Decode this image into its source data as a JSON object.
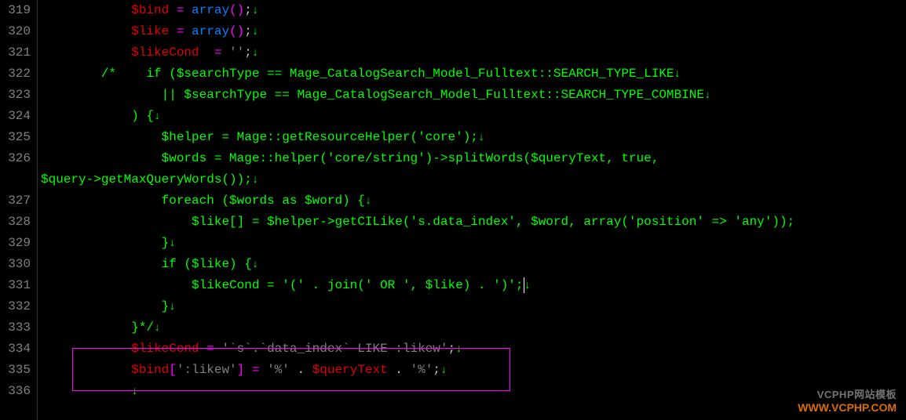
{
  "gutter": {
    "lines": [
      "319",
      "320",
      "321",
      "322",
      "323",
      "324",
      "325",
      "326",
      "",
      "327",
      "328",
      "329",
      "330",
      "331",
      "332",
      "333",
      "334",
      "335",
      "336"
    ]
  },
  "code": {
    "l319": {
      "indent": "            ",
      "var": "$bind",
      "eq": " = ",
      "op": "array",
      "paren": "()",
      "semi": ";"
    },
    "l320": {
      "indent": "            ",
      "var": "$like",
      "eq": " = ",
      "op": "array",
      "paren": "()",
      "semi": ";"
    },
    "l321": {
      "indent": "            ",
      "var": "$likeCond",
      "eq": "  = ",
      "str": "''",
      "semi": ";"
    },
    "l322": {
      "indent": "        ",
      "cp": "/*",
      "cg": "    if ($searchType == Mage_CatalogSearch_Model_Fulltext::SEARCH_TYPE_LIKE"
    },
    "l323": {
      "indent": "                ",
      "cg": "|| $searchType == Mage_CatalogSearch_Model_Fulltext::SEARCH_TYPE_COMBINE"
    },
    "l324": {
      "indent": "            ",
      "cg": ") {"
    },
    "l325": {
      "indent": "                ",
      "cg": "$helper = Mage::getResourceHelper('core');"
    },
    "l326a": {
      "indent": "                ",
      "cg": "$words = Mage::helper('core/string')->splitWords($queryText, true, "
    },
    "l326b": {
      "cg": "$query->getMaxQueryWords());"
    },
    "l327": {
      "indent": "                ",
      "cg": "foreach ($words as $word) {"
    },
    "l328": {
      "indent": "                    ",
      "cg": "$like[] = $helper->getCILike('s.data_index', $word, array('position' => 'any'));"
    },
    "l329": {
      "indent": "                ",
      "cg": "}"
    },
    "l330": {
      "indent": "                ",
      "cg": "if ($like) {"
    },
    "l331": {
      "indent": "                    ",
      "cg": "$likeCond = '(' . join(' OR ', $like) . ')';"
    },
    "l332": {
      "indent": "                ",
      "cg": "}"
    },
    "l333": {
      "indent": "            ",
      "cg": "}*/"
    },
    "l334": {
      "indent": "            ",
      "var": "$likeCond",
      "eq": " = ",
      "str": "'`s`.`data_index` LIKE :likew'",
      "semi": ";"
    },
    "l335": {
      "indent": "            ",
      "var": "$bind",
      "idx": "[':likew']",
      "eq": " = ",
      "str1": "'%'",
      "dot1": " . ",
      "var2": "$queryText",
      "dot2": " . ",
      "str2": "'%'",
      "semi": ";"
    }
  },
  "branding": {
    "line1": "VCPHP网站模板",
    "line2": "WWW.VCPHP.COM"
  },
  "newline": "↓"
}
